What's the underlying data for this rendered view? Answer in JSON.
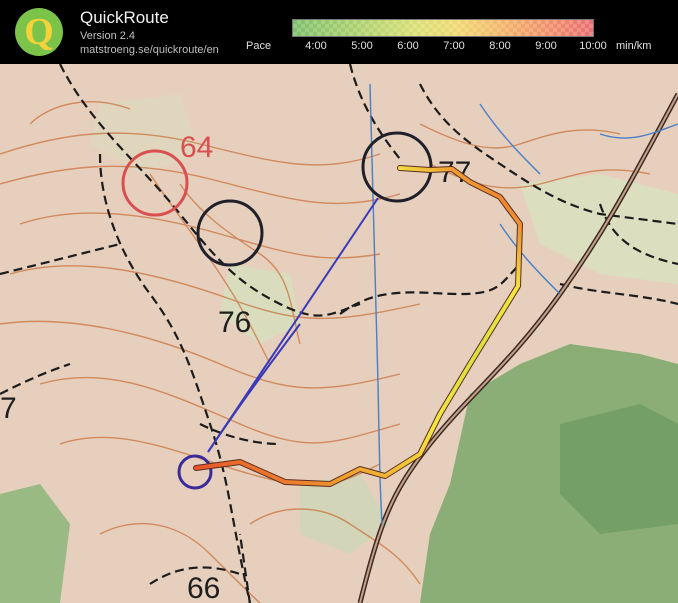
{
  "header": {
    "title": "QuickRoute",
    "version": "Version 2.4",
    "url": "matstroeng.se/quickroute/en"
  },
  "pace_legend": {
    "label": "Pace",
    "ticks": [
      "4:00",
      "5:00",
      "6:00",
      "7:00",
      "8:00",
      "9:00",
      "10:00"
    ],
    "unit": "min/km"
  },
  "map": {
    "controls": [
      "64",
      "76",
      "77",
      "66",
      "7"
    ]
  },
  "colors": {
    "route_slow": "#e84a2a",
    "route_fast": "#f4e640",
    "control_circle": "#20202a",
    "prev_control": "#d85050"
  }
}
